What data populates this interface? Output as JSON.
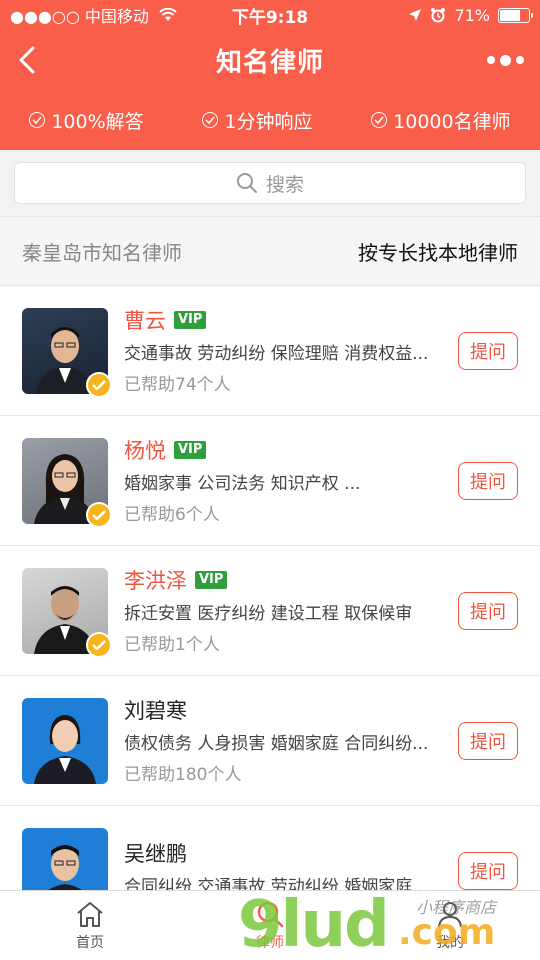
{
  "status_bar": {
    "carrier": "●●●○○ 中国移动",
    "time": "下午9:18",
    "battery_text": "71%",
    "battery_level": 0.71
  },
  "nav": {
    "title": "知名律师"
  },
  "badges": [
    "100%解答",
    "1分钟响应",
    "10000名律师"
  ],
  "search": {
    "placeholder": "搜索"
  },
  "section": {
    "left": "秦皇岛市知名律师",
    "right": "按专长找本地律师"
  },
  "ask_label": "提问",
  "vip_label": "VIP",
  "lawyers": [
    {
      "name": "曹云",
      "vip": true,
      "verified": true,
      "tags": "交通事故 劳动纠纷 保险理赔 消费权益...",
      "helped": "已帮助74个人"
    },
    {
      "name": "杨悦",
      "vip": true,
      "verified": true,
      "tags": "婚姻家事 公司法务 知识产权 ...",
      "helped": "已帮助6个人"
    },
    {
      "name": "李洪泽",
      "vip": true,
      "verified": true,
      "tags": "拆迁安置 医疗纠纷 建设工程 取保候审",
      "helped": "已帮助1个人"
    },
    {
      "name": "刘碧寒",
      "vip": false,
      "verified": false,
      "tags": "债权债务 人身损害 婚姻家庭 合同纠纷...",
      "helped": "已帮助180个人"
    },
    {
      "name": "吴继鹏",
      "vip": false,
      "verified": false,
      "tags": "合同纠纷 交通事故 劳动纠纷 婚姻家庭...",
      "helped": ""
    }
  ],
  "tabs": [
    {
      "label": "首页",
      "icon": "home-icon"
    },
    {
      "label": "律师",
      "icon": "search-icon",
      "active": true
    },
    {
      "label": "我的",
      "icon": "person-icon"
    }
  ],
  "watermark": {
    "brand": "9lud",
    "suffix": ".com",
    "tagline": "小程序商店"
  },
  "colors": {
    "brand": "#f95e4b",
    "vip_green": "#2f9e3c",
    "verified": "#f6b51a"
  }
}
